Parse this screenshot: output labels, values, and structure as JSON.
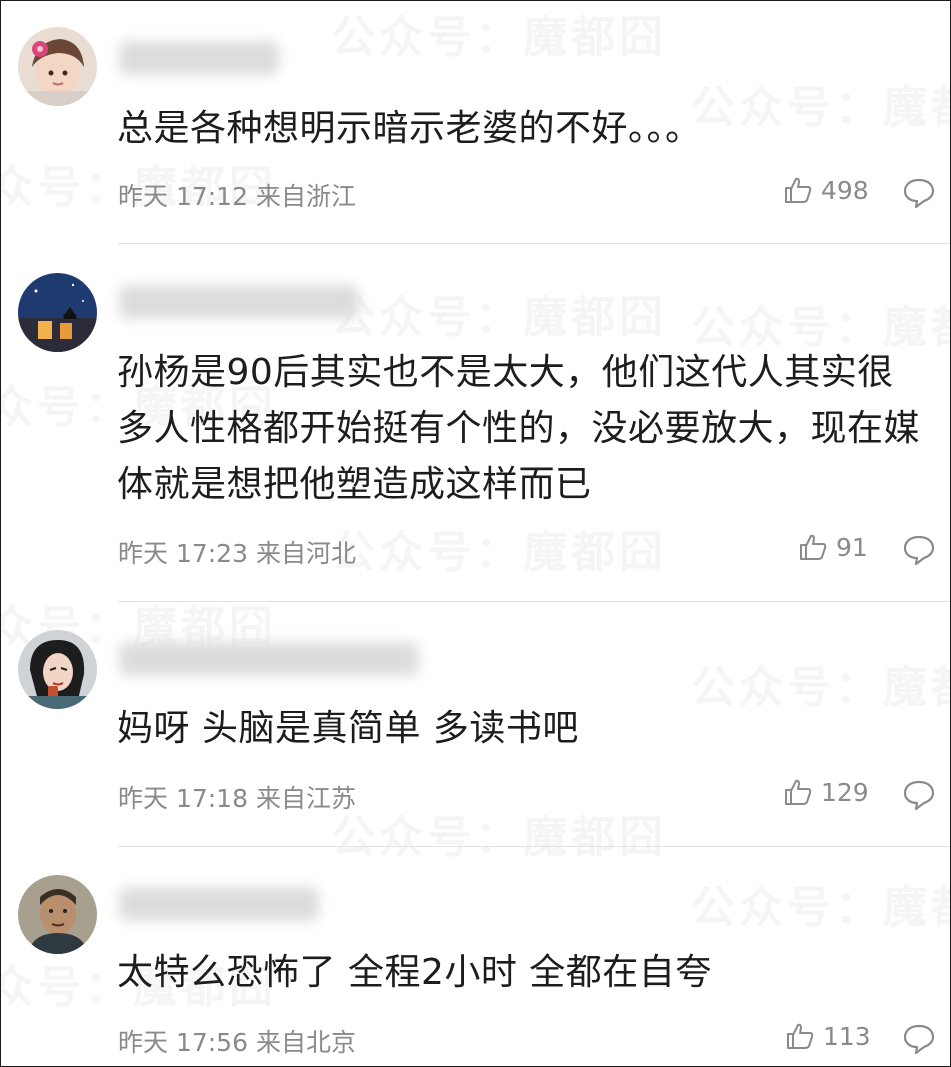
{
  "watermark": "公众号：魔都囧",
  "comments": [
    {
      "text": "总是各种想明示暗示老婆的不好。。。",
      "meta": "昨天 17:12 来自浙江",
      "likes": "498",
      "avatar_desc": "girl-with-flower"
    },
    {
      "text": "孙杨是90后其实也不是太大，他们这代人其实很多人性格都开始挺有个性的，没必要放大，现在媒体就是想把他塑造成这样而已",
      "meta": "昨天 17:23 来自河北",
      "likes": "91",
      "avatar_desc": "night-sky-cat"
    },
    {
      "text": "妈呀 头脑是真简单 多读书吧",
      "meta": "昨天 17:18 来自江苏",
      "likes": "129",
      "avatar_desc": "illustrated-woman"
    },
    {
      "text": "太特么恐怖了 全程2小时 全都在自夸",
      "meta": "昨天 17:56 来自北京",
      "likes": "113",
      "avatar_desc": "man-portrait"
    }
  ]
}
